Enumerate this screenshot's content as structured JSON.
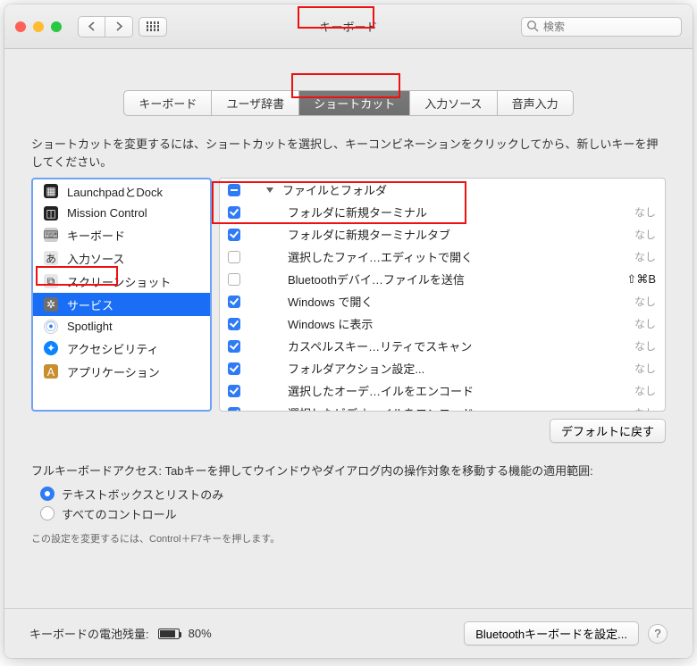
{
  "window": {
    "title": "キーボード"
  },
  "search": {
    "placeholder": "検索"
  },
  "tabs": [
    {
      "label": "キーボード"
    },
    {
      "label": "ユーザ辞書"
    },
    {
      "label": "ショートカット",
      "active": true
    },
    {
      "label": "入力ソース"
    },
    {
      "label": "音声入力"
    }
  ],
  "instruction": "ショートカットを変更するには、ショートカットを選択し、キーコンビネーションをクリックしてから、新しいキーを押してください。",
  "categories": [
    {
      "name": "LaunchpadとDock",
      "icon": "launchpad",
      "bg": "#222"
    },
    {
      "name": "Mission Control",
      "icon": "mission",
      "bg": "#222"
    },
    {
      "name": "キーボード",
      "icon": "keyboard",
      "bg": "#9a9a9a"
    },
    {
      "name": "入力ソース",
      "icon": "input",
      "bg": "#c8c8c8"
    },
    {
      "name": "スクリーンショット",
      "icon": "screenshot",
      "bg": "#c8c8c8"
    },
    {
      "name": "サービス",
      "icon": "gear",
      "bg": "#7b7b7b",
      "selected": true
    },
    {
      "name": "Spotlight",
      "icon": "spotlight",
      "bg": "#fff"
    },
    {
      "name": "アクセシビリティ",
      "icon": "accessibility",
      "bg": "#0a84ff"
    },
    {
      "name": "アプリケーション",
      "icon": "app",
      "bg": "#f0ba38"
    }
  ],
  "shortcut_group_label": "ファイルとフォルダ",
  "shortcuts": [
    {
      "label": "フォルダに新規ターミナル",
      "checked": true,
      "key": "なし"
    },
    {
      "label": "フォルダに新規ターミナルタブ",
      "checked": true,
      "key": "なし"
    },
    {
      "label": "選択したファイ…エディットで開く",
      "checked": false,
      "key": "なし"
    },
    {
      "label": "Bluetoothデバイ…ファイルを送信",
      "checked": false,
      "key": "⇧⌘B",
      "has": true
    },
    {
      "label": "Windows で開く",
      "checked": true,
      "key": "なし"
    },
    {
      "label": "Windows に表示",
      "checked": true,
      "key": "なし"
    },
    {
      "label": "カスペルスキー…リティでスキャン",
      "checked": true,
      "key": "なし"
    },
    {
      "label": "フォルダアクション設定...",
      "checked": true,
      "key": "なし"
    },
    {
      "label": "選択したオーデ…イルをエンコード",
      "checked": true,
      "key": "なし"
    },
    {
      "label": "選択したビデオ…イルをエンコード",
      "checked": true,
      "key": "なし"
    }
  ],
  "reset_defaults_label": "デフォルトに戻す",
  "fka": {
    "desc": "フルキーボードアクセス: Tabキーを押してウインドウやダイアログ内の操作対象を移動する機能の適用範囲:",
    "options": [
      {
        "label": "テキストボックスとリストのみ",
        "selected": true
      },
      {
        "label": "すべてのコントロール",
        "selected": false
      }
    ],
    "hint": "この設定を変更するには、Control＋F7キーを押します。"
  },
  "footer": {
    "battery_label": "キーボードの電池残量:",
    "battery_value": "80%",
    "bt_keyboard_label": "Bluetoothキーボードを設定...",
    "help": "?"
  }
}
